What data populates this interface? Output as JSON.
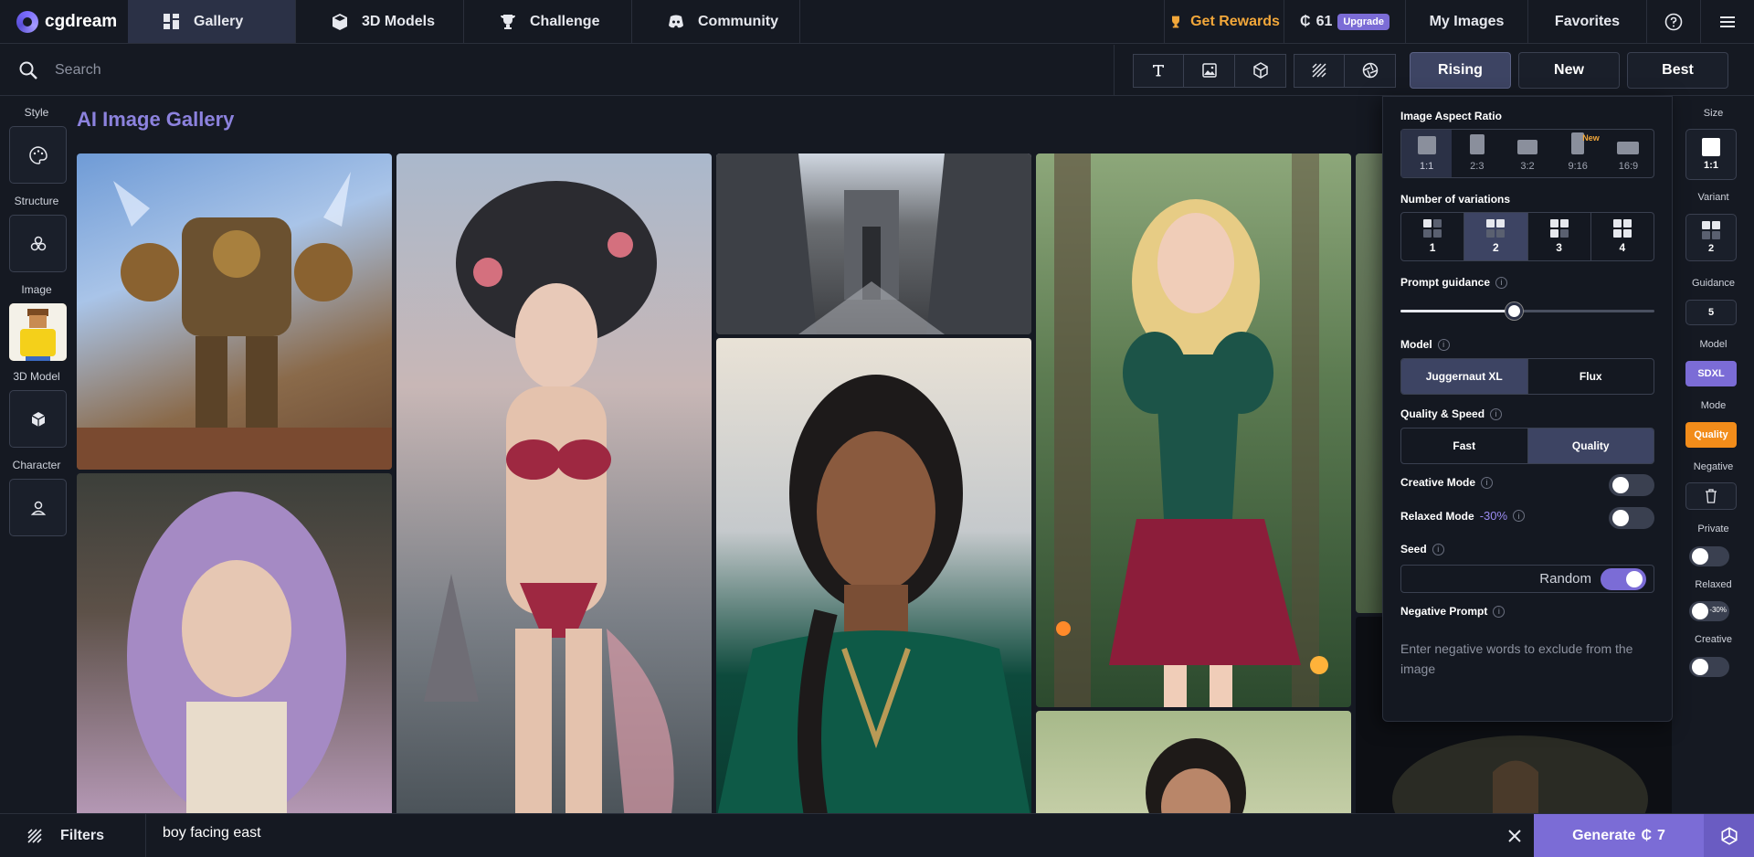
{
  "app": {
    "name": "cgdream"
  },
  "nav": {
    "tabs": [
      {
        "label": "Gallery",
        "icon": "gallery-icon",
        "active": true
      },
      {
        "label": "3D Models",
        "icon": "cube-icon",
        "active": false
      },
      {
        "label": "Challenge",
        "icon": "trophy-icon",
        "active": false
      },
      {
        "label": "Community",
        "icon": "discord-icon",
        "active": false
      }
    ],
    "rewards": "Get Rewards",
    "credits": "61",
    "upgrade": "Upgrade",
    "my_images": "My Images",
    "favorites": "Favorites"
  },
  "search": {
    "placeholder": "Search"
  },
  "sort": [
    "Rising",
    "New",
    "Best"
  ],
  "sort_active": "Rising",
  "left_sidebar": {
    "style": "Style",
    "structure": "Structure",
    "image": "Image",
    "model3d": "3D Model",
    "character": "Character"
  },
  "gallery": {
    "title": "AI Image Gallery"
  },
  "panel": {
    "aspect_label": "Image Aspect Ratio",
    "aspects": [
      {
        "label": "1:1",
        "active": true,
        "badge": ""
      },
      {
        "label": "2:3",
        "active": false,
        "badge": ""
      },
      {
        "label": "3:2",
        "active": false,
        "badge": ""
      },
      {
        "label": "9:16",
        "active": false,
        "badge": "New"
      },
      {
        "label": "16:9",
        "active": false,
        "badge": ""
      }
    ],
    "variations_label": "Number of variations",
    "variations": [
      "1",
      "2",
      "3",
      "4"
    ],
    "variations_selected": 2,
    "guidance_label": "Prompt guidance",
    "guidance_fraction": 0.45,
    "model_label": "Model",
    "models": [
      "Juggernaut XL",
      "Flux"
    ],
    "quality_label": "Quality & Speed",
    "quality": [
      "Fast",
      "Quality"
    ],
    "creative_label": "Creative Mode",
    "relaxed_label": "Relaxed Mode",
    "relaxed_pct": "-30%",
    "seed_label": "Seed",
    "seed_value": "Random",
    "negative_label": "Negative Prompt",
    "negative_placeholder": "Enter negative words to exclude from the image"
  },
  "right_column": {
    "size_label": "Size",
    "size_value": "1:1",
    "variant_label": "Variant",
    "variant_value": "2",
    "guidance_label": "Guidance",
    "guidance_value": "5",
    "model_label": "Model",
    "model_value": "SDXL",
    "mode_label": "Mode",
    "mode_value": "Quality",
    "negative_label": "Negative",
    "private_label": "Private",
    "relaxed_label": "Relaxed",
    "relaxed_mini": "-30%",
    "creative_label": "Creative"
  },
  "bottom": {
    "filters": "Filters",
    "prompt": "boy facing east",
    "generate": "Generate",
    "generate_cost": "7"
  },
  "colors": {
    "background": "#151922",
    "accent": "#7b6cd6",
    "title": "#8c82de",
    "rewards": "#f2a73a",
    "mode_pill": "#f28c1a"
  }
}
